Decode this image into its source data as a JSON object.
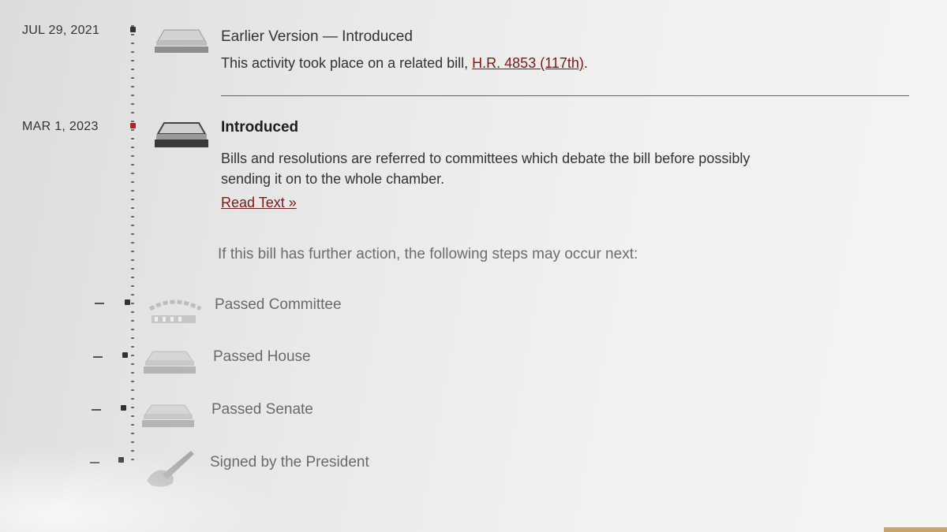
{
  "timeline": {
    "earlier": {
      "date": "JUL 29, 2021",
      "title": "Earlier Version — Introduced",
      "description_prefix": "This activity took place on a related bill, ",
      "related_bill_link": "H.R. 4853 (117th)",
      "description_suffix": "."
    },
    "current": {
      "date": "MAR 1, 2023",
      "title": "Introduced",
      "description_line1": "Bills and resolutions are referred to committees which debate the bill before possibly",
      "description_line2": "sending it on to the whole chamber.",
      "read_text_link": "Read Text »"
    },
    "next_steps_note": "If this bill has further action, the following steps may occur next:",
    "future_steps": [
      {
        "label": "Passed Committee",
        "date": "—",
        "icon": "committee-icon"
      },
      {
        "label": "Passed House",
        "date": "—",
        "icon": "chamber-icon"
      },
      {
        "label": "Passed Senate",
        "date": "—",
        "icon": "chamber-icon"
      },
      {
        "label": "Signed by the President",
        "date": "—",
        "icon": "pen-signing-icon"
      }
    ]
  },
  "colors": {
    "active_node": "#b22222",
    "link": "#7a1a1a",
    "divider": "#5a6470"
  }
}
